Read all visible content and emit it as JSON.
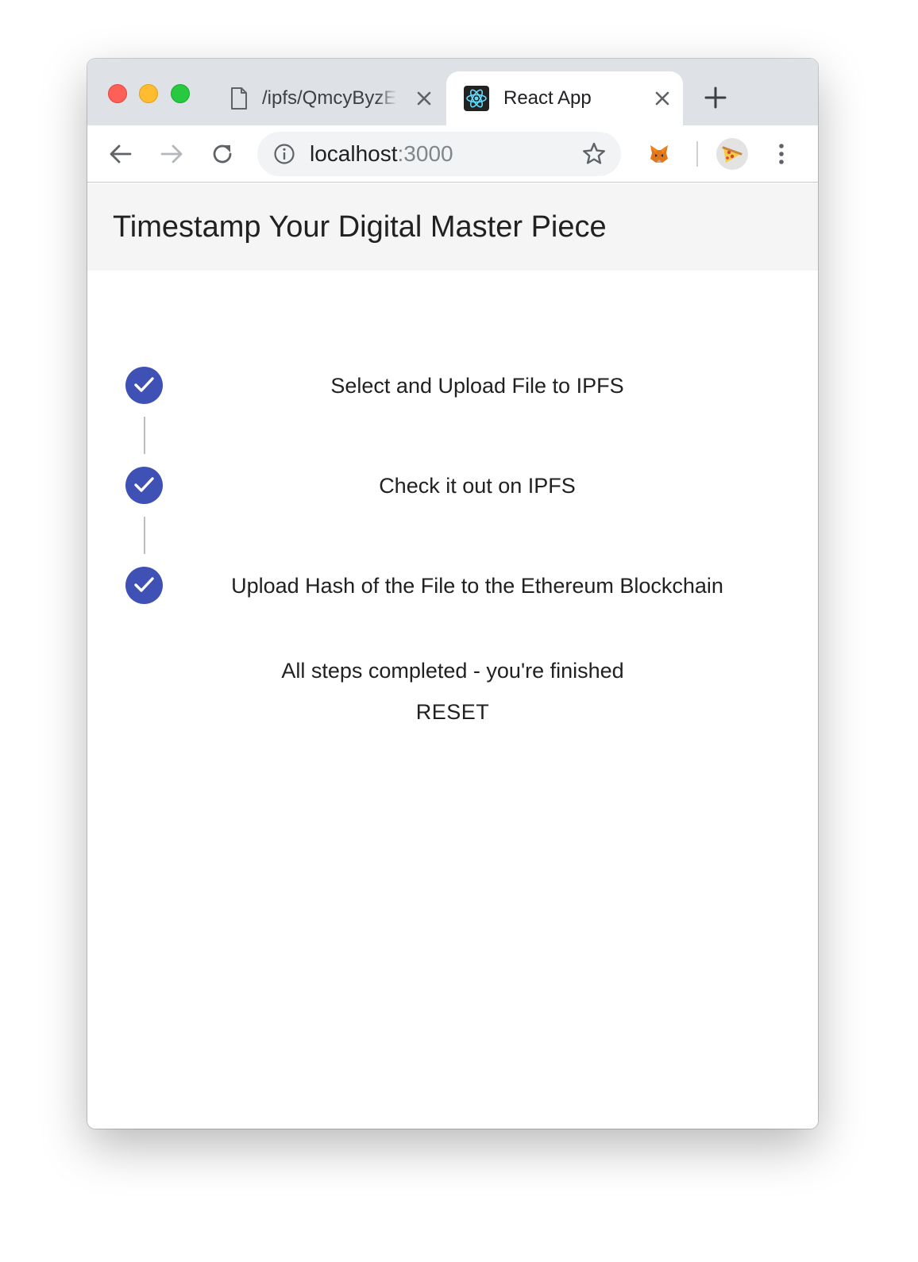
{
  "browser": {
    "tabs": [
      {
        "title": "/ipfs/QmcyByzEr",
        "icon": "document-icon",
        "active": false
      },
      {
        "title": "React App",
        "icon": "react-icon",
        "active": true
      }
    ],
    "address": {
      "host": "localhost",
      "port": ":3000"
    },
    "extensions": [
      "metamask-fox-icon",
      "profile-avatar"
    ]
  },
  "app": {
    "title": "Timestamp Your Digital Master Piece",
    "steps": [
      {
        "label": "Select and Upload File to IPFS",
        "completed": true
      },
      {
        "label": "Check it out on IPFS",
        "completed": true
      },
      {
        "label": "Upload Hash of the File to the Ethereum Blockchain",
        "completed": true
      }
    ],
    "finished_message": "All steps completed - you're finished",
    "reset_label": "RESET"
  },
  "colors": {
    "step_accent": "#3f51b5",
    "app_bar": "#f5f5f5",
    "tab_strip": "#dee1e6"
  }
}
